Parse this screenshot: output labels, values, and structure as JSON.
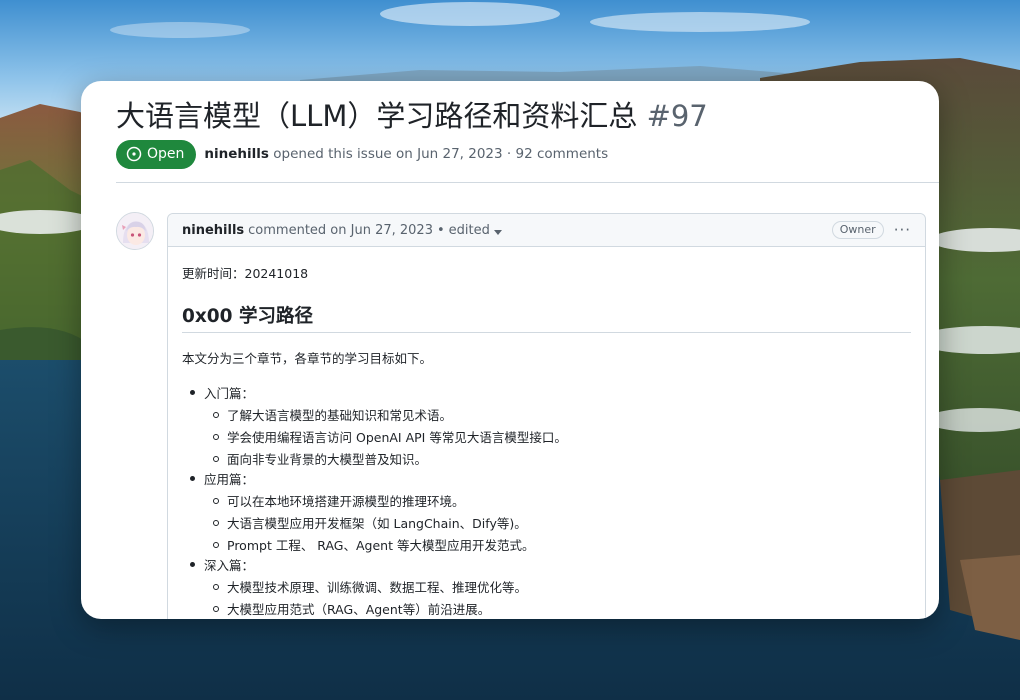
{
  "issue": {
    "title": "大语言模型（LLM）学习路径和资料汇总",
    "number": "#97",
    "status": "Open",
    "author": "ninehills",
    "meta": "opened this issue on Jun 27, 2023 · 92 comments"
  },
  "comment": {
    "author": "ninehills",
    "action": "commented on Jun 27, 2023",
    "dot": "•",
    "edited": "edited",
    "role_badge": "Owner",
    "menu": "···",
    "updated": "更新时间：20241018",
    "heading": "0x00 学习路径",
    "intro": "本文分为三个章节，各章节的学习目标如下。",
    "sections": [
      {
        "label": "入门篇：",
        "items": [
          "了解大语言模型的基础知识和常见术语。",
          "学会使用编程语言访问 OpenAI API 等常见大语言模型接口。",
          "面向非专业背景的大模型普及知识。"
        ]
      },
      {
        "label": "应用篇：",
        "items": [
          "可以在本地环境搭建开源模型的推理环境。",
          "大语言模型应用开发框架（如 LangChain、Dify等)。",
          "Prompt 工程、 RAG、Agent 等大模型应用开发范式。"
        ]
      },
      {
        "label": "深入篇：",
        "items": [
          "大模型技术原理、训练微调、数据工程、推理优化等。",
          "大模型应用范式（RAG、Agent等）前沿进展。"
        ]
      }
    ]
  },
  "colors": {
    "open_green": "#1f883d",
    "text_primary": "#1f2328",
    "text_muted": "#59636e",
    "border": "#d1d9e0",
    "header_bg": "#f6f8fa"
  },
  "icons": {
    "status": "issue-opened-icon",
    "caret": "caret-down-icon",
    "menu": "kebab-menu-icon"
  }
}
